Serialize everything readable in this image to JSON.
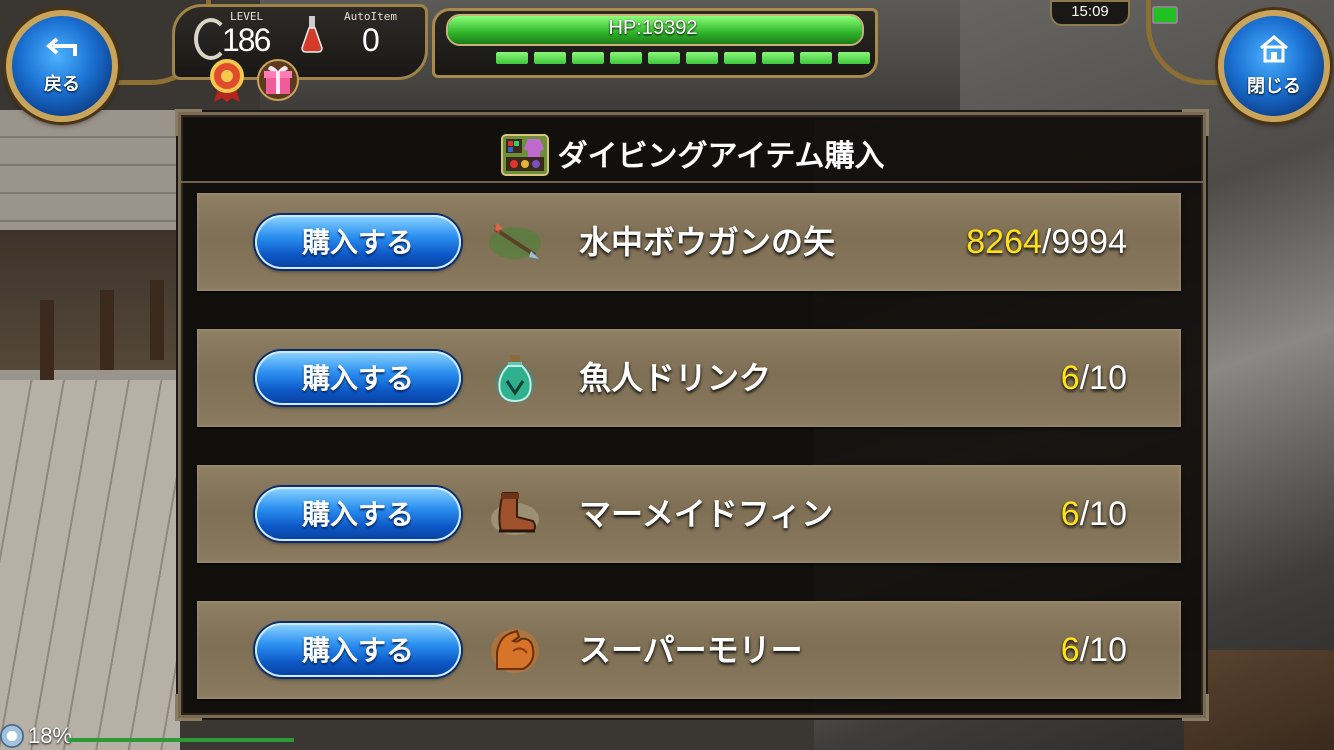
{
  "hud": {
    "back_label": "戻る",
    "close_label": "閉じる",
    "level_label": "LEVEL",
    "level_value": "186",
    "autoitem_label": "AutoItem",
    "autoitem_value": "0",
    "hp_text": "HP:19392",
    "hp_fraction": 1.0,
    "stamina_segments": 10,
    "clock": "15:09",
    "loading_percent": "18%"
  },
  "panel": {
    "title": "ダイビングアイテム購入"
  },
  "items": [
    {
      "button": "購入する",
      "icon": "crossbow-bolt-icon",
      "name": "水中ボウガンの矢",
      "have": "8264",
      "sep": "/",
      "max": "9994"
    },
    {
      "button": "購入する",
      "icon": "potion-bottle-icon",
      "name": "魚人ドリンク",
      "have": "6",
      "sep": "/",
      "max": "10"
    },
    {
      "button": "購入する",
      "icon": "boot-icon",
      "name": "マーメイドフィン",
      "have": "6",
      "sep": "/",
      "max": "10"
    },
    {
      "button": "購入する",
      "icon": "muscle-arm-icon",
      "name": "スーパーモリー",
      "have": "6",
      "sep": "/",
      "max": "10"
    }
  ],
  "colors": {
    "button_blue": "#2b8ff0",
    "count_highlight": "#ffe11a",
    "hp_green": "#2fb42a",
    "row_bg": "#8a7a5f"
  }
}
